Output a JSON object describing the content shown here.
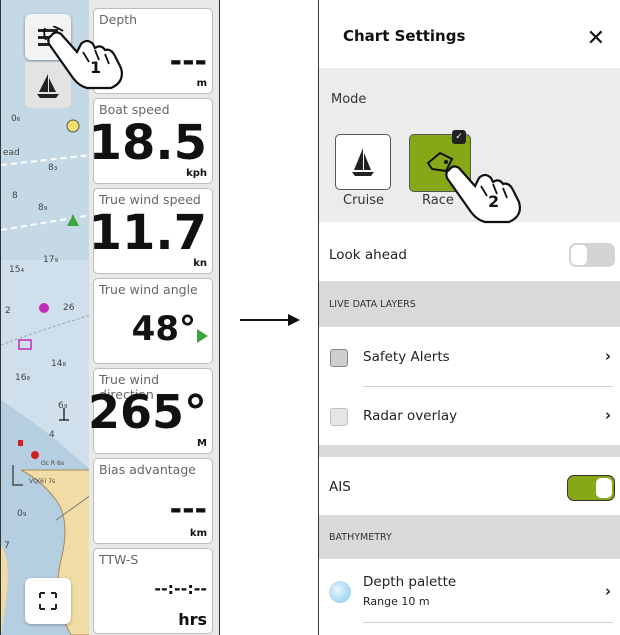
{
  "left_screen": {
    "chart_labels": [
      "0₆",
      "ead",
      "8₃",
      "8",
      "8₉",
      "15₄",
      "17₉",
      "2",
      "26",
      "14₈",
      "16₈",
      "6₉",
      "4",
      "0₉",
      "7"
    ],
    "tiles": [
      {
        "label": "Depth",
        "value": "---",
        "unit": "m"
      },
      {
        "label": "Boat speed",
        "value": "18.5",
        "unit": "kph"
      },
      {
        "label": "True wind speed",
        "value": "11.7",
        "unit": "kn"
      },
      {
        "label": "True wind angle",
        "value": "48°",
        "unit": ""
      },
      {
        "label": "True wind direction",
        "value": "265°",
        "unit": "M"
      },
      {
        "label": "Bias advantage",
        "value": "---",
        "unit": "km"
      },
      {
        "label": "TTW-S",
        "value": "--:--:--",
        "unit": "hrs"
      }
    ],
    "step1_label": "1",
    "colors": {
      "water": "#cfe0ec",
      "land": "#f2dca6",
      "accent": "#86a816"
    }
  },
  "right_screen": {
    "title": "Chart Settings",
    "close_icon": "close-icon",
    "mode_label": "Mode",
    "modes": [
      {
        "label": "Cruise",
        "selected": false
      },
      {
        "label": "Race",
        "selected": true
      }
    ],
    "step2_label": "2",
    "look_ahead": {
      "label": "Look ahead",
      "on": false
    },
    "live_data_header": "LIVE DATA LAYERS",
    "safety_alerts": "Safety Alerts",
    "radar_overlay": "Radar overlay",
    "ais": {
      "label": "AIS",
      "on": true
    },
    "bathymetry_header": "BATHYMETRY",
    "depth_palette": {
      "label": "Depth palette",
      "sub": "Range 10 m"
    },
    "colors": {
      "accent": "#86a816",
      "section": "#d9d9d9"
    }
  }
}
